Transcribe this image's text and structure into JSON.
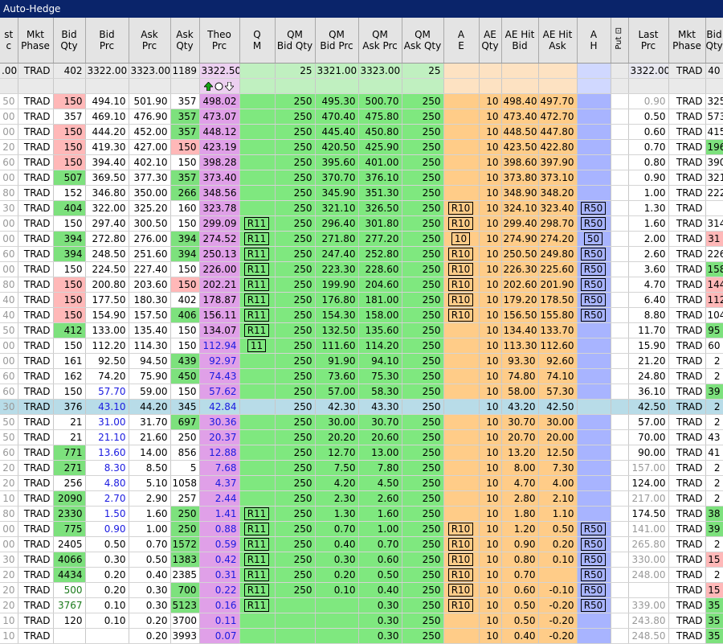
{
  "window": {
    "title": "Auto-Hedge"
  },
  "colors": {
    "bid_highlight": "#7de17d",
    "ask_highlight": "#ffb8b8",
    "theo": "#e0a0e8",
    "qm": "#7fe87f",
    "ae": "#ffcc88",
    "ah": "#a8b4ff",
    "title_bar": "#0a246a",
    "atm_row": "#b8dce8"
  },
  "columns": [
    "st\nc",
    "Mkt\nPhase",
    "Bid\nQty",
    "Bid\nPrc",
    "Ask\nPrc",
    "Ask\nQty",
    "Theo\nPrc",
    "Q\nM",
    "QM\nBid Qty",
    "QM\nBid Prc",
    "QM\nAsk Prc",
    "QM\nAsk Qty",
    "A\nE",
    "AE\nQty",
    "AE Hit\nBid",
    "AE Hit\nAsk",
    "A\nH",
    "Put",
    "Last\nPrc",
    "Mkt\nPhase",
    "Bid\nQty"
  ],
  "header_icons": {
    "put": "put-filter-icon",
    "theo_controls": [
      "arrow-up-icon",
      "circle-icon",
      "arrow-down-icon"
    ]
  },
  "top_row": {
    "st": ".00",
    "phase": "TRAD",
    "bid_qty": "402",
    "bid_prc": "3322.00",
    "ask_prc": "3323.00",
    "ask_qty": "1189",
    "theo": "3322.50",
    "qm": "",
    "qm_bid_qty": "25",
    "qm_bid_prc": "3321.00",
    "qm_ask_prc": "3323.00",
    "qm_ask_qty": "25",
    "ae": "",
    "ae_qty": "",
    "ae_hit_bid": "",
    "ae_hit_ask": "",
    "ah": "",
    "put": "",
    "last": "3322.00",
    "phase2": "TRAD",
    "bid2": "40"
  },
  "rows": [
    [
      "50",
      "TRAD",
      "150",
      "494.10",
      "501.90",
      "357",
      "498.02",
      "",
      "250",
      "495.30",
      "500.70",
      "250",
      "",
      "10",
      "498.40",
      "497.70",
      "",
      "",
      "0.90",
      "TRAD",
      "325"
    ],
    [
      "00",
      "TRAD",
      "357",
      "469.10",
      "476.90",
      "357",
      "473.07",
      "",
      "250",
      "470.40",
      "475.80",
      "250",
      "",
      "10",
      "473.40",
      "472.70",
      "",
      "",
      "0.50",
      "TRAD",
      "573"
    ],
    [
      "00",
      "TRAD",
      "150",
      "444.20",
      "452.00",
      "357",
      "448.12",
      "",
      "250",
      "445.40",
      "450.80",
      "250",
      "",
      "10",
      "448.50",
      "447.80",
      "",
      "",
      "0.60",
      "TRAD",
      "415"
    ],
    [
      "20",
      "TRAD",
      "150",
      "419.30",
      "427.00",
      "150",
      "423.19",
      "",
      "250",
      "420.50",
      "425.90",
      "250",
      "",
      "10",
      "423.50",
      "422.80",
      "",
      "",
      "0.70",
      "TRAD",
      "196"
    ],
    [
      "60",
      "TRAD",
      "150",
      "394.40",
      "402.10",
      "150",
      "398.28",
      "",
      "250",
      "395.60",
      "401.00",
      "250",
      "",
      "10",
      "398.60",
      "397.90",
      "",
      "",
      "0.80",
      "TRAD",
      "390"
    ],
    [
      "00",
      "TRAD",
      "507",
      "369.50",
      "377.30",
      "357",
      "373.40",
      "",
      "250",
      "370.70",
      "376.10",
      "250",
      "",
      "10",
      "373.80",
      "373.10",
      "",
      "",
      "0.90",
      "TRAD",
      "321"
    ],
    [
      "80",
      "TRAD",
      "152",
      "346.80",
      "350.00",
      "266",
      "348.56",
      "",
      "250",
      "345.90",
      "351.30",
      "250",
      "",
      "10",
      "348.90",
      "348.20",
      "",
      "",
      "1.00",
      "TRAD",
      "222"
    ],
    [
      "30",
      "TRAD",
      "404",
      "322.00",
      "325.20",
      "160",
      "323.78",
      "",
      "250",
      "321.10",
      "326.50",
      "250",
      "R10",
      "10",
      "324.10",
      "323.40",
      "R50",
      "",
      "1.30",
      "TRAD",
      ""
    ],
    [
      "00",
      "TRAD",
      "150",
      "297.40",
      "300.50",
      "150",
      "299.09",
      "R11",
      "250",
      "296.40",
      "301.80",
      "250",
      "R10",
      "10",
      "299.40",
      "298.70",
      "R50",
      "",
      "1.60",
      "TRAD",
      "314"
    ],
    [
      "00",
      "TRAD",
      "394",
      "272.80",
      "276.00",
      "394",
      "274.52",
      "R11",
      "250",
      "271.80",
      "277.20",
      "250",
      "10",
      "10",
      "274.90",
      "274.20",
      "50",
      "",
      "2.00",
      "TRAD",
      "31"
    ],
    [
      "60",
      "TRAD",
      "394",
      "248.50",
      "251.60",
      "394",
      "250.13",
      "R11",
      "250",
      "247.40",
      "252.80",
      "250",
      "R10",
      "10",
      "250.50",
      "249.80",
      "R50",
      "",
      "2.60",
      "TRAD",
      "226"
    ],
    [
      "00",
      "TRAD",
      "150",
      "224.50",
      "227.40",
      "150",
      "226.00",
      "R11",
      "250",
      "223.30",
      "228.60",
      "250",
      "R10",
      "10",
      "226.30",
      "225.60",
      "R50",
      "",
      "3.60",
      "TRAD",
      "158"
    ],
    [
      "80",
      "TRAD",
      "150",
      "200.80",
      "203.60",
      "150",
      "202.21",
      "R11",
      "250",
      "199.90",
      "204.60",
      "250",
      "R10",
      "10",
      "202.60",
      "201.90",
      "R50",
      "",
      "4.70",
      "TRAD",
      "144"
    ],
    [
      "40",
      "TRAD",
      "150",
      "177.50",
      "180.30",
      "402",
      "178.87",
      "R11",
      "250",
      "176.80",
      "181.00",
      "250",
      "R10",
      "10",
      "179.20",
      "178.50",
      "R50",
      "",
      "6.40",
      "TRAD",
      "112"
    ],
    [
      "40",
      "TRAD",
      "150",
      "154.90",
      "157.50",
      "406",
      "156.11",
      "R11",
      "250",
      "154.30",
      "158.00",
      "250",
      "R10",
      "10",
      "156.50",
      "155.80",
      "R50",
      "",
      "8.80",
      "TRAD",
      "104"
    ],
    [
      "50",
      "TRAD",
      "412",
      "133.00",
      "135.40",
      "150",
      "134.07",
      "R11",
      "250",
      "132.50",
      "135.60",
      "250",
      "",
      "10",
      "134.40",
      "133.70",
      "",
      "",
      "11.70",
      "TRAD",
      "95"
    ],
    [
      "00",
      "TRAD",
      "150",
      "112.20",
      "114.30",
      "150",
      "112.94",
      "11",
      "250",
      "111.60",
      "114.20",
      "250",
      "",
      "10",
      "113.30",
      "112.60",
      "",
      "",
      "15.90",
      "TRAD",
      "60"
    ],
    [
      "00",
      "TRAD",
      "161",
      "92.50",
      "94.50",
      "439",
      "92.97",
      "",
      "250",
      "91.90",
      "94.10",
      "250",
      "",
      "10",
      "93.30",
      "92.60",
      "",
      "",
      "21.20",
      "TRAD",
      "2"
    ],
    [
      "60",
      "TRAD",
      "162",
      "74.20",
      "75.90",
      "450",
      "74.43",
      "",
      "250",
      "73.60",
      "75.30",
      "250",
      "",
      "10",
      "74.80",
      "74.10",
      "",
      "",
      "24.80",
      "TRAD",
      "2"
    ],
    [
      "60",
      "TRAD",
      "150",
      "57.70",
      "59.00",
      "150",
      "57.62",
      "",
      "250",
      "57.00",
      "58.30",
      "250",
      "",
      "10",
      "58.00",
      "57.30",
      "",
      "",
      "36.10",
      "TRAD",
      "39"
    ],
    [
      "30",
      "TRAD",
      "376",
      "43.10",
      "44.20",
      "345",
      "42.84",
      "",
      "250",
      "42.30",
      "43.30",
      "250",
      "",
      "10",
      "43.20",
      "42.50",
      "",
      "",
      "42.50",
      "TRAD",
      "2"
    ],
    [
      "50",
      "TRAD",
      "21",
      "31.00",
      "31.70",
      "697",
      "30.36",
      "",
      "250",
      "30.00",
      "30.70",
      "250",
      "",
      "10",
      "30.70",
      "30.00",
      "",
      "",
      "57.00",
      "TRAD",
      "2"
    ],
    [
      "50",
      "TRAD",
      "21",
      "21.10",
      "21.60",
      "250",
      "20.37",
      "",
      "250",
      "20.20",
      "20.60",
      "250",
      "",
      "10",
      "20.70",
      "20.00",
      "",
      "",
      "70.00",
      "TRAD",
      "43"
    ],
    [
      "60",
      "TRAD",
      "771",
      "13.60",
      "14.00",
      "856",
      "12.88",
      "",
      "250",
      "12.70",
      "13.00",
      "250",
      "",
      "10",
      "13.20",
      "12.50",
      "",
      "",
      "90.00",
      "TRAD",
      "41"
    ],
    [
      "20",
      "TRAD",
      "271",
      "8.30",
      "8.50",
      "5",
      "7.68",
      "",
      "250",
      "7.50",
      "7.80",
      "250",
      "",
      "10",
      "8.00",
      "7.30",
      "",
      "",
      "157.00",
      "TRAD",
      "2"
    ],
    [
      "20",
      "TRAD",
      "256",
      "4.80",
      "5.10",
      "1058",
      "4.37",
      "",
      "250",
      "4.20",
      "4.50",
      "250",
      "",
      "10",
      "4.70",
      "4.00",
      "",
      "",
      "124.00",
      "TRAD",
      "2"
    ],
    [
      "10",
      "TRAD",
      "2090",
      "2.70",
      "2.90",
      "257",
      "2.44",
      "",
      "250",
      "2.30",
      "2.60",
      "250",
      "",
      "10",
      "2.80",
      "2.10",
      "",
      "",
      "217.00",
      "TRAD",
      "2"
    ],
    [
      "80",
      "TRAD",
      "2330",
      "1.50",
      "1.60",
      "250",
      "1.41",
      "R11",
      "250",
      "1.30",
      "1.60",
      "250",
      "",
      "10",
      "1.80",
      "1.10",
      "",
      "",
      "174.50",
      "TRAD",
      "38"
    ],
    [
      "00",
      "TRAD",
      "775",
      "0.90",
      "1.00",
      "250",
      "0.88",
      "R11",
      "250",
      "0.70",
      "1.00",
      "250",
      "R10",
      "10",
      "1.20",
      "0.50",
      "R50",
      "",
      "141.00",
      "TRAD",
      "39"
    ],
    [
      "00",
      "TRAD",
      "2405",
      "0.50",
      "0.70",
      "1572",
      "0.59",
      "R11",
      "250",
      "0.40",
      "0.70",
      "250",
      "R10",
      "10",
      "0.90",
      "0.20",
      "R50",
      "",
      "265.80",
      "TRAD",
      "2"
    ],
    [
      "30",
      "TRAD",
      "4066",
      "0.30",
      "0.50",
      "1383",
      "0.42",
      "R11",
      "250",
      "0.30",
      "0.60",
      "250",
      "R10",
      "10",
      "0.80",
      "0.10",
      "R50",
      "",
      "330.00",
      "TRAD",
      "15"
    ],
    [
      "20",
      "TRAD",
      "4434",
      "0.20",
      "0.40",
      "2385",
      "0.31",
      "R11",
      "250",
      "0.20",
      "0.50",
      "250",
      "R10",
      "10",
      "0.70",
      "",
      "R50",
      "",
      "248.00",
      "TRAD",
      "2"
    ],
    [
      "20",
      "TRAD",
      "500",
      "0.20",
      "0.30",
      "700",
      "0.22",
      "R11",
      "250",
      "0.10",
      "0.40",
      "250",
      "R10",
      "10",
      "0.60",
      "-0.10",
      "R50",
      "",
      "",
      "TRAD",
      "15"
    ],
    [
      "20",
      "TRAD",
      "3767",
      "0.10",
      "0.30",
      "5123",
      "0.16",
      "R11",
      "",
      "",
      "0.30",
      "250",
      "R10",
      "10",
      "0.50",
      "-0.20",
      "R50",
      "",
      "339.00",
      "TRAD",
      "35"
    ],
    [
      "10",
      "TRAD",
      "120",
      "0.10",
      "0.20",
      "3700",
      "0.11",
      "",
      "",
      "",
      "0.30",
      "250",
      "",
      "10",
      "0.50",
      "-0.20",
      "",
      "",
      "243.80",
      "TRAD",
      "35"
    ],
    [
      "10",
      "TRAD",
      "",
      "",
      "0.20",
      "3993",
      "0.07",
      "",
      "",
      "",
      "0.30",
      "250",
      "",
      "10",
      "0.40",
      "-0.20",
      "",
      "",
      "248.50",
      "TRAD",
      "35"
    ]
  ]
}
